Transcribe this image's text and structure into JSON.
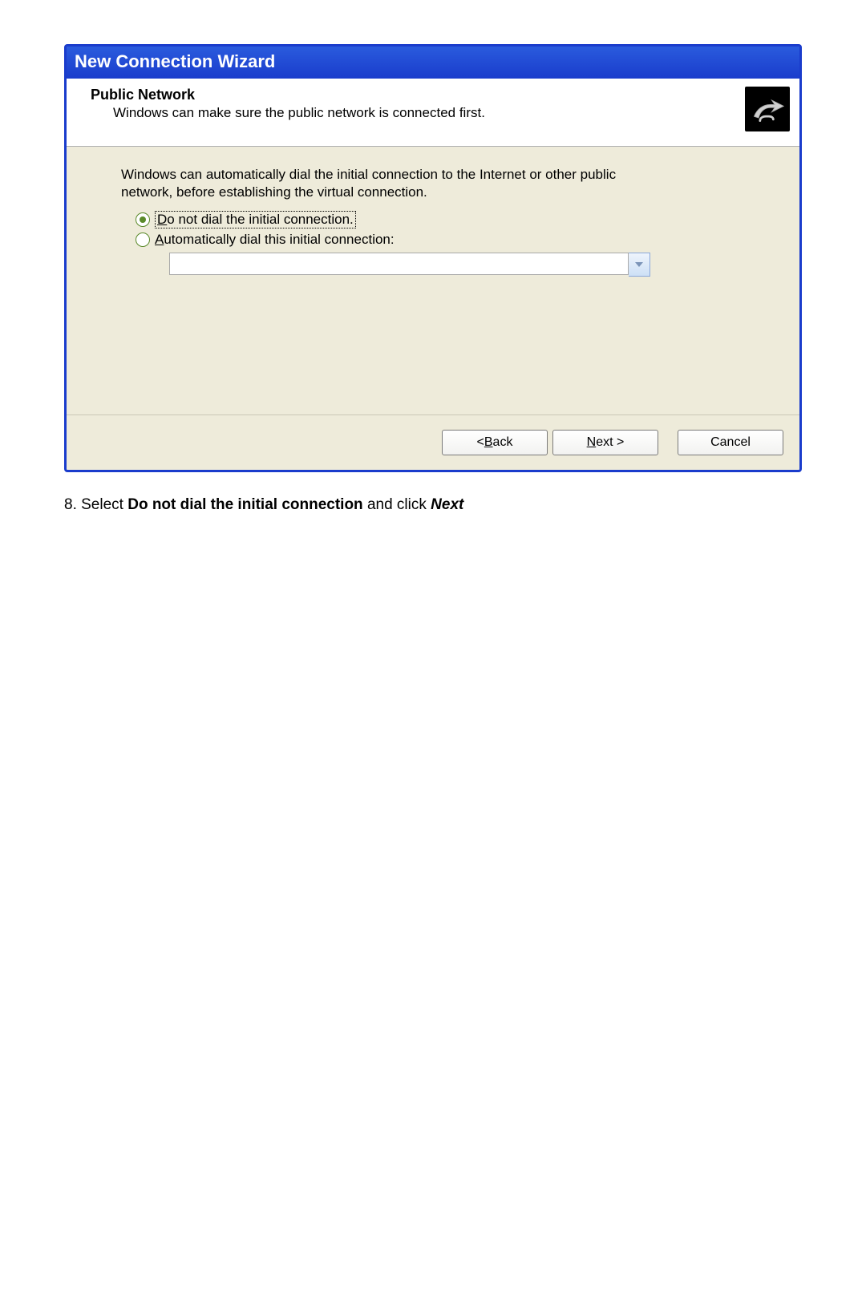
{
  "wizard": {
    "title": "New Connection Wizard",
    "header_title": "Public Network",
    "header_subtitle": "Windows can make sure the public network is connected first.",
    "body_text": "Windows can automatically dial the initial connection to the Internet or other public network, before establishing the virtual connection.",
    "options": {
      "opt1_pre": "D",
      "opt1_rest": "o not dial the initial connection.",
      "opt2_pre": "A",
      "opt2_rest": "utomatically dial this initial connection:"
    },
    "dropdown_value": "",
    "buttons": {
      "back_pre": "< ",
      "back_u": "B",
      "back_rest": "ack",
      "next_u": "N",
      "next_rest": "ext >",
      "cancel": "Cancel"
    }
  },
  "instruction": {
    "num": "8. ",
    "pre": "Select ",
    "bold": "Do not dial the initial connection",
    "mid": " and click ",
    "ital": "Next"
  }
}
